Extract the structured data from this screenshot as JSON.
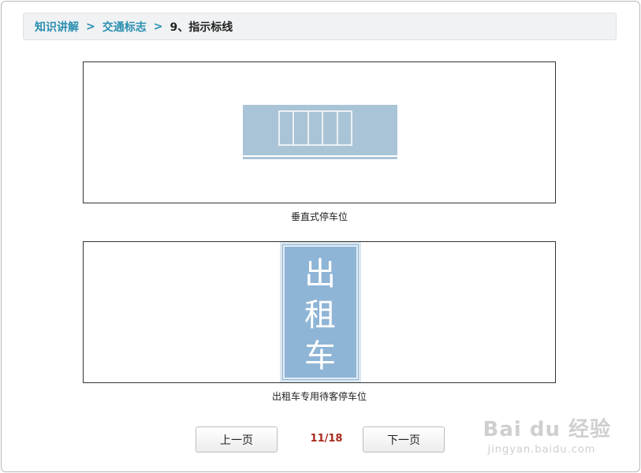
{
  "breadcrumb": {
    "items": [
      "知识讲解",
      "交通标志"
    ],
    "current": "9、指示标线",
    "separator": ">"
  },
  "figures": [
    {
      "caption": "垂直式停车位"
    },
    {
      "caption": "出租车专用待客停车位",
      "sign_text": [
        "出",
        "租",
        "车"
      ]
    }
  ],
  "pager": {
    "prev_label": "上一页",
    "next_label": "下一页",
    "current": "11/18"
  },
  "watermark": {
    "logo_text": "Bai du 经验",
    "url_text": "jingyan.baidu.com"
  },
  "colors": {
    "accent": "#2a8fb0",
    "count": "#a8281c",
    "sign_blue": "#8fb5d6",
    "road_blue": "#a9c4d6"
  }
}
